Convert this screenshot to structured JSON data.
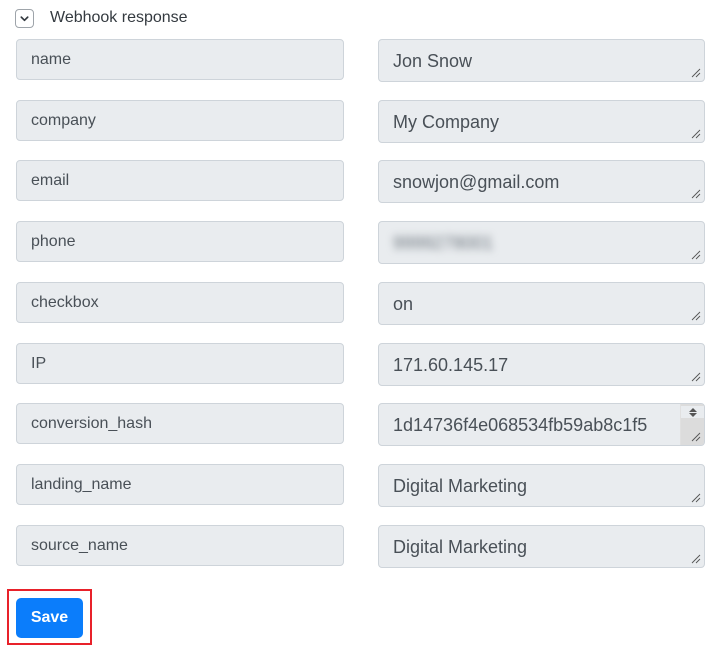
{
  "section": {
    "title": "Webhook response",
    "toggle_icon": "chevron-down-icon",
    "expanded": true
  },
  "fields": [
    {
      "key": "name",
      "value": "Jon Snow"
    },
    {
      "key": "company",
      "value": "My Company"
    },
    {
      "key": "email",
      "value": "snowjon@gmail.com"
    },
    {
      "key": "phone",
      "value": "9999278001",
      "blurred": true
    },
    {
      "key": "checkbox",
      "value": "on"
    },
    {
      "key": "IP",
      "value": "171.60.145.17"
    },
    {
      "key": "conversion_hash",
      "value": "1d14736f4e068534fb59ab8c1f5",
      "scrollable": true
    },
    {
      "key": "landing_name",
      "value": "Digital Marketing"
    },
    {
      "key": "source_name",
      "value": "Digital Marketing"
    }
  ],
  "actions": {
    "save_label": "Save",
    "save_color": "#0b7dfb",
    "highlight_color": "#e8212a"
  }
}
